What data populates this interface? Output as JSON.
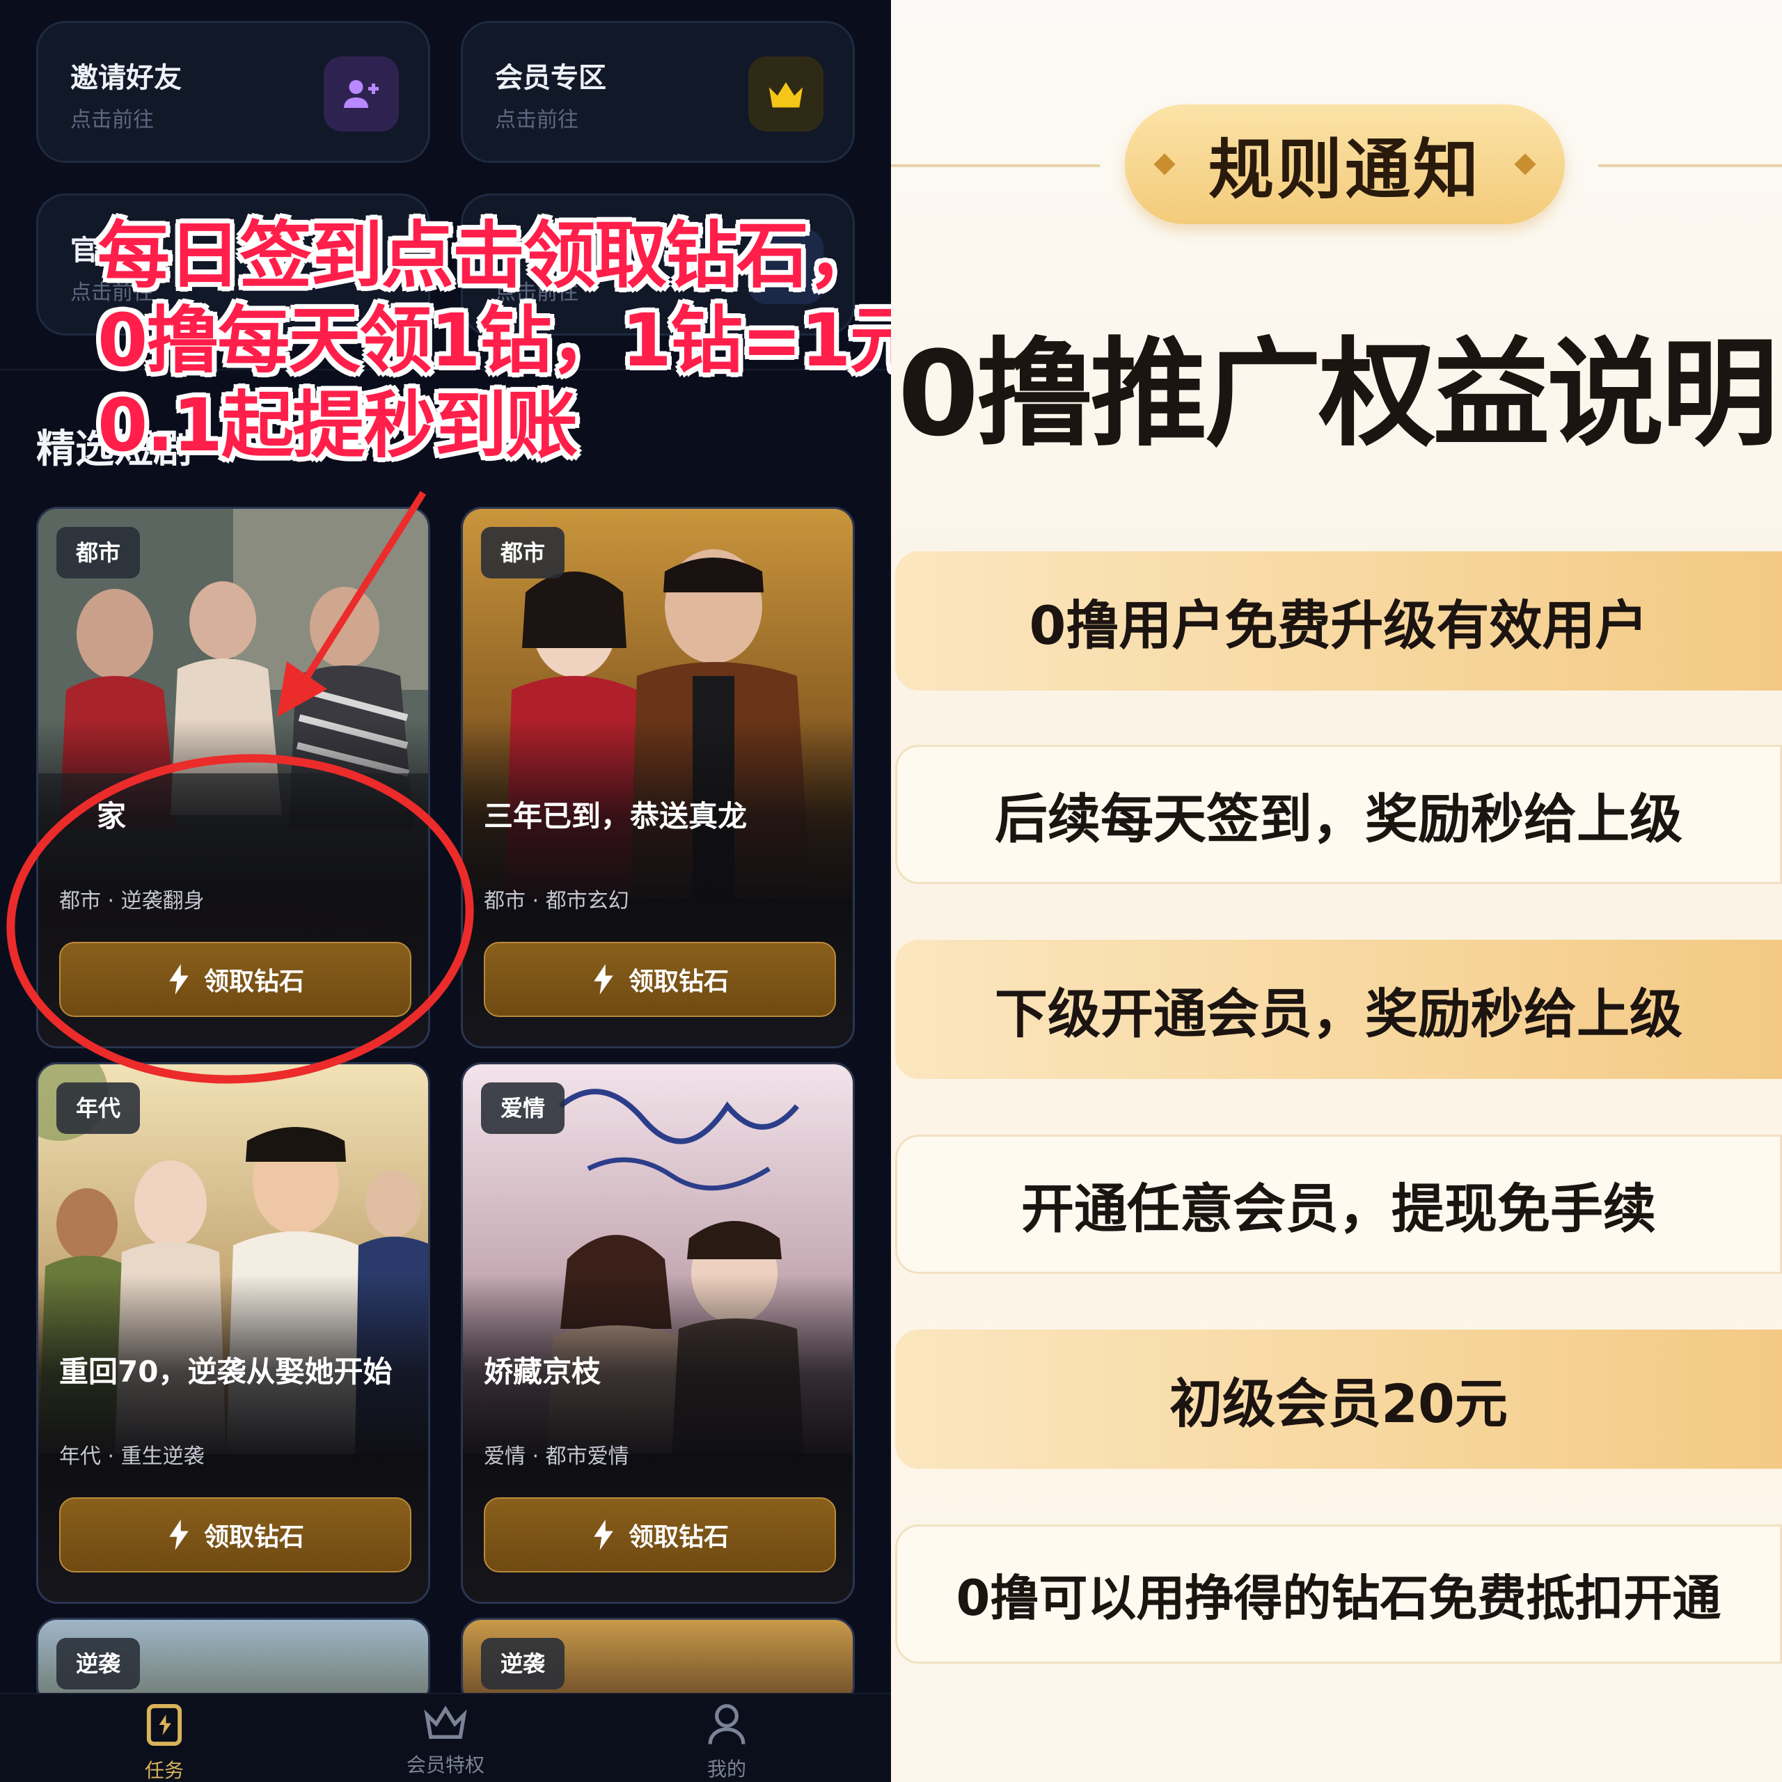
{
  "quick_cards": [
    {
      "title": "邀请好友",
      "subtitle": "点击前往"
    },
    {
      "title": "会员专区",
      "subtitle": "点击前往"
    },
    {
      "title": "官",
      "subtitle": "点击前往"
    },
    {
      "title": "",
      "subtitle": "点击前往"
    }
  ],
  "section_title": "精选短剧",
  "dramas": [
    {
      "tag": "都市",
      "title": "家",
      "meta": "都市 · 逆袭翻身",
      "button": "领取钻石"
    },
    {
      "tag": "都市",
      "title": "三年已到，恭送真龙",
      "meta": "都市 · 都市玄幻",
      "button": "领取钻石"
    },
    {
      "tag": "年代",
      "title": "重回70，逆袭从娶她开始",
      "meta": "年代 · 重生逆袭",
      "button": "领取钻石"
    },
    {
      "tag": "爱情",
      "title": "娇藏京枝",
      "meta": "爱情 · 都市爱情",
      "button": "领取钻石"
    },
    {
      "tag": "逆袭"
    },
    {
      "tag": "逆袭"
    }
  ],
  "bottom_nav": [
    {
      "label": "任务",
      "icon": "task-icon"
    },
    {
      "label": "会员特权",
      "icon": "crown-icon"
    },
    {
      "label": "我的",
      "icon": "user-icon"
    }
  ],
  "overlay_lines": [
    "每日签到点击领取钻石，",
    "0撸每天领1钻，1钻=1元",
    "0.1起提秒到账"
  ],
  "rules": {
    "badge": "规则通知",
    "heading": "0撸推广权益说明",
    "items": [
      "0撸用户免费升级有效用户",
      "后续每天签到，奖励秒给上级",
      "下级开通会员，奖励秒给上级",
      "开通任意会员，提现免手续",
      "初级会员20元",
      "0撸可以用挣得的钻石免费抵扣开通"
    ]
  },
  "colors": {
    "app_bg": "#0a0e1c",
    "button_gold": "#7d5518",
    "annotation_red": "#ff1f4a",
    "rule_gold": "#f7d69c"
  }
}
